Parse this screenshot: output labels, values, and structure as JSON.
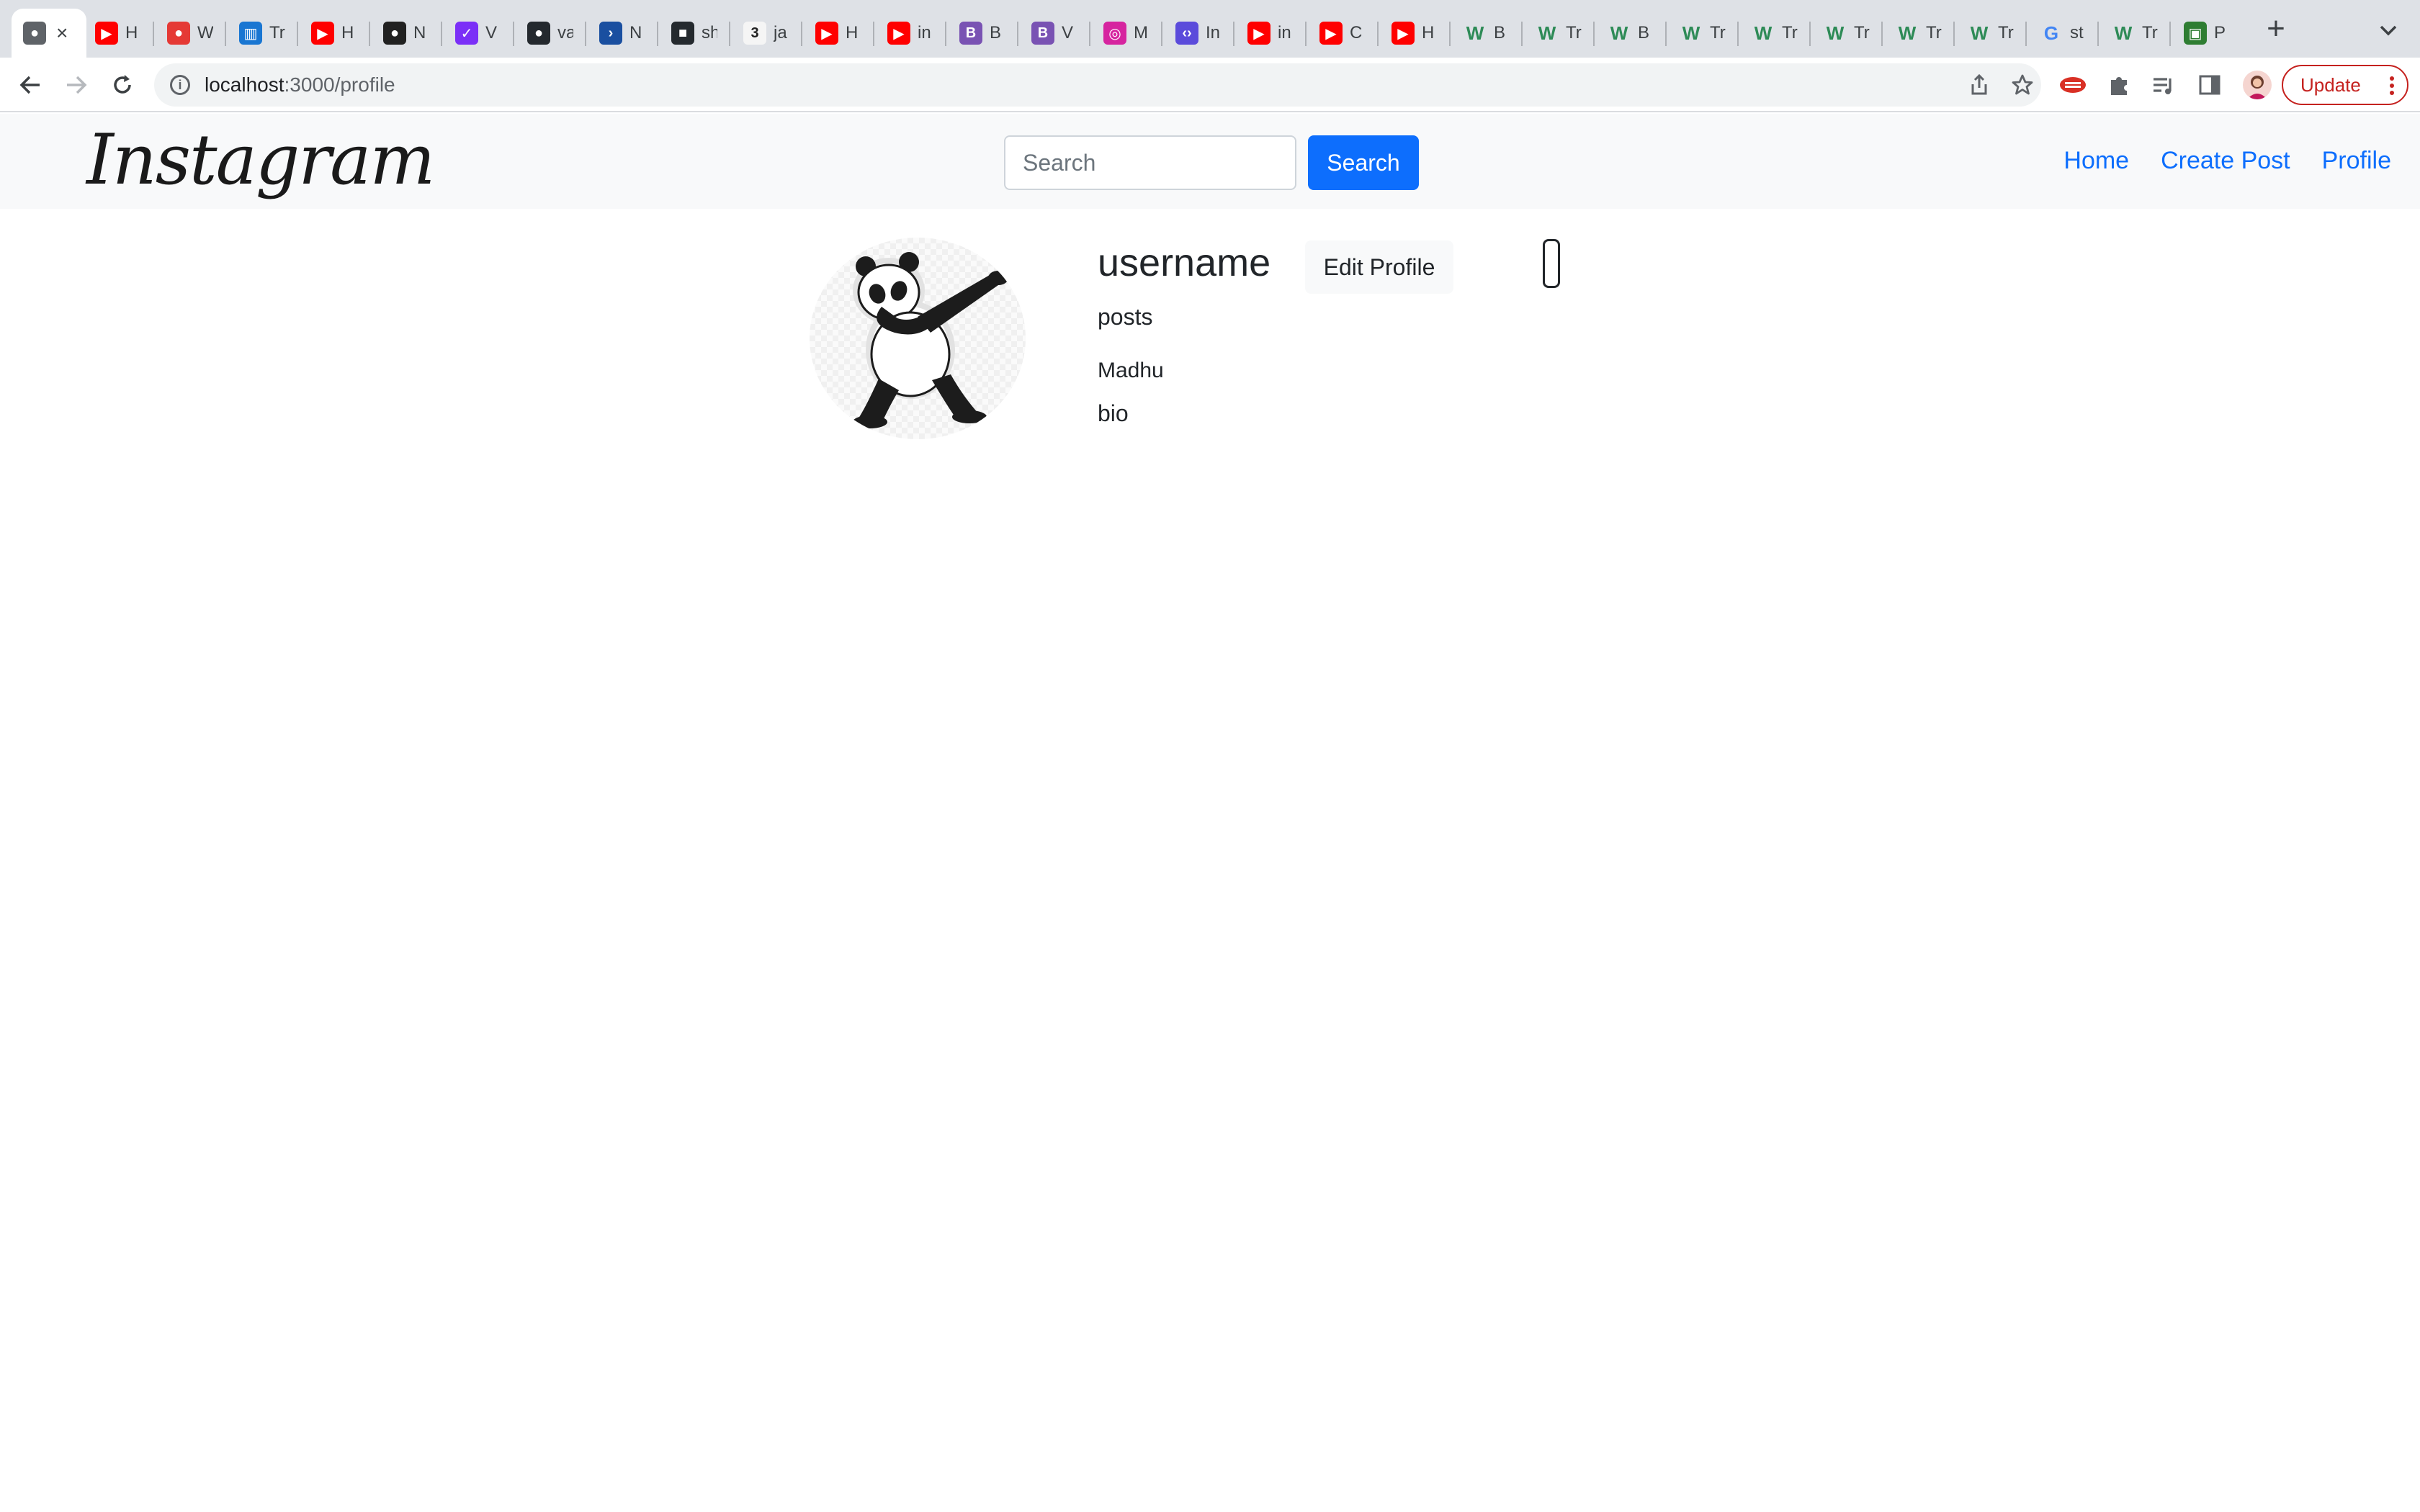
{
  "browser": {
    "tabs": [
      {
        "title": "",
        "icon": "globe-icon",
        "active": true
      },
      {
        "title": "H",
        "icon": "youtube-icon"
      },
      {
        "title": "W",
        "icon": "red-circle-icon"
      },
      {
        "title": "Tr",
        "icon": "trello-icon"
      },
      {
        "title": "H",
        "icon": "youtube-icon"
      },
      {
        "title": "N",
        "icon": "monkey-icon"
      },
      {
        "title": "V",
        "icon": "purple-check-icon"
      },
      {
        "title": "va",
        "icon": "github-icon"
      },
      {
        "title": "N",
        "icon": "blue-bracket-icon"
      },
      {
        "title": "sh",
        "icon": "github-square-icon"
      },
      {
        "title": "ja",
        "icon": "three-icon"
      },
      {
        "title": "H",
        "icon": "youtube-icon"
      },
      {
        "title": "in",
        "icon": "youtube-icon"
      },
      {
        "title": "B",
        "icon": "bootstrap-icon"
      },
      {
        "title": "V",
        "icon": "bootstrap-icon"
      },
      {
        "title": "M",
        "icon": "instagram-icon"
      },
      {
        "title": "In",
        "icon": "code-icon"
      },
      {
        "title": "in",
        "icon": "youtube-icon"
      },
      {
        "title": "C",
        "icon": "youtube-icon"
      },
      {
        "title": "H",
        "icon": "youtube-icon"
      },
      {
        "title": "B",
        "icon": "w-green-icon"
      },
      {
        "title": "Tr",
        "icon": "w-green-icon"
      },
      {
        "title": "B",
        "icon": "w-green-icon"
      },
      {
        "title": "Tr",
        "icon": "w-green-icon"
      },
      {
        "title": "Tr",
        "icon": "w-green-icon"
      },
      {
        "title": "Tr",
        "icon": "w-green-icon"
      },
      {
        "title": "Tr",
        "icon": "w-green-icon"
      },
      {
        "title": "Tr",
        "icon": "w-green-icon"
      },
      {
        "title": "st",
        "icon": "google-icon"
      },
      {
        "title": "Tr",
        "icon": "w-green-icon"
      },
      {
        "title": "P",
        "icon": "pc-icon"
      }
    ],
    "url_host": "localhost",
    "url_path": ":3000/profile",
    "update_label": "Update"
  },
  "navbar": {
    "brand": "Instagram",
    "search_placeholder": "Search",
    "search_button": "Search",
    "links": [
      "Home",
      "Create Post",
      "Profile"
    ],
    "link_color": "#0d6efd"
  },
  "profile": {
    "username": "username",
    "edit_button": "Edit Profile",
    "posts_label": "posts",
    "name": "Madhu",
    "bio": "bio"
  },
  "colors": {
    "primary": "#0d6efd",
    "update": "#c5221f"
  }
}
